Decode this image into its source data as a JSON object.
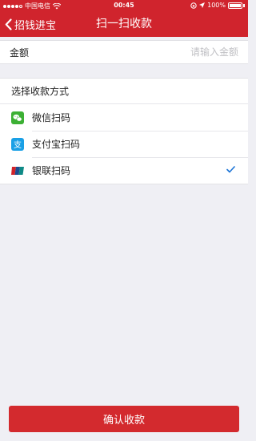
{
  "status_bar": {
    "carrier": "中国电信",
    "time": "00:45",
    "battery": "100%"
  },
  "nav": {
    "back_label": "招钱进宝",
    "title": "扫一扫收款"
  },
  "amount": {
    "label": "金额",
    "placeholder": "请输入金额"
  },
  "payment": {
    "header": "选择收款方式",
    "methods": [
      {
        "label": "微信扫码",
        "icon": "wechat-icon",
        "color": "#3cb034",
        "selected": false
      },
      {
        "label": "支付宝扫码",
        "icon": "alipay-icon",
        "color": "#1aa0e6",
        "selected": false
      },
      {
        "label": "银联扫码",
        "icon": "unionpay-icon",
        "color": "#d2232a",
        "selected": true
      }
    ]
  },
  "confirm_label": "确认收款",
  "colors": {
    "brand_red": "#d0242d",
    "check_blue": "#1a73d6"
  }
}
